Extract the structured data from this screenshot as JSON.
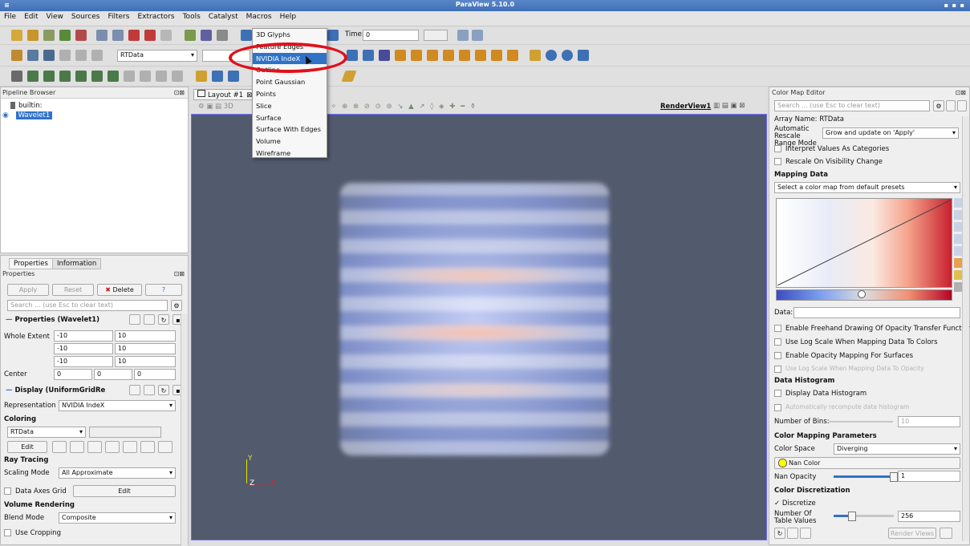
{
  "window": {
    "title": "ParaView 5.10.0",
    "controls": "▪ ▪ ▪"
  },
  "menubar": {
    "items": [
      "File",
      "Edit",
      "View",
      "Sources",
      "Filters",
      "Extractors",
      "Tools",
      "Catalyst",
      "Macros",
      "Help"
    ]
  },
  "toolbar": {
    "time_label": "Time:",
    "time_value": "0",
    "array_selector": "RTData"
  },
  "representation_menu": {
    "items": [
      "3D Glyphs",
      "Feature Edges",
      "NVIDIA IndeX",
      "Outline",
      "Point Gaussian",
      "Points",
      "Slice",
      "Surface",
      "Surface With Edges",
      "Volume",
      "Wireframe"
    ],
    "highlighted": "NVIDIA IndeX"
  },
  "pipeline": {
    "title": "Pipeline Browser",
    "root": "builtin:",
    "item": "Wavelet1"
  },
  "properties": {
    "tabs": [
      "Properties",
      "Information"
    ],
    "title": "Properties",
    "apply": "Apply",
    "reset": "Reset",
    "delete": "Delete",
    "help": "?",
    "search_placeholder": "Search ... (use Esc to clear text)",
    "section_props": "Properties (Wavelet1)",
    "whole_extent_label": "Whole Extent",
    "extent": [
      [
        "-10",
        "10"
      ],
      [
        "-10",
        "10"
      ],
      [
        "-10",
        "10"
      ]
    ],
    "center_label": "Center",
    "center": [
      "0",
      "0",
      "0"
    ],
    "section_display": "Display (UniformGridRe",
    "representation_label": "Representation",
    "representation_value": "NVIDIA IndeX",
    "coloring_label": "Coloring",
    "coloring_value": "RTData",
    "edit_label": "Edit",
    "ray_tracing_label": "Ray Tracing",
    "scaling_mode_label": "Scaling Mode",
    "scaling_mode_value": "All Approximate",
    "data_axes_grid": "Data Axes Grid",
    "data_axes_edit": "Edit",
    "volume_rendering_label": "Volume Rendering",
    "blend_mode_label": "Blend Mode",
    "blend_mode_value": "Composite",
    "use_cropping": "Use Cropping"
  },
  "view": {
    "layout_tab": "Layout #1",
    "render_view": "RenderView1",
    "axis_y": "Y",
    "axis_z": "Z",
    "axis_x": "X",
    "mode_3d": "3D"
  },
  "colormap": {
    "title": "Color Map Editor",
    "search_placeholder": "Search ... (use Esc to clear text)",
    "array_name": "Array Name: RTData",
    "auto_rescale_label": "Automatic Rescale Range Mode",
    "auto_rescale_value": "Grow and update on 'Apply'",
    "interpret_categories": "Interpret Values As Categories",
    "rescale_visibility": "Rescale On Visibility Change",
    "mapping_data": "Mapping Data",
    "preset_placeholder": "Select a color map from default presets",
    "data_label": "Data:",
    "freehand": "Enable Freehand Drawing Of Opacity Transfer Function",
    "log_scale": "Use Log Scale When Mapping Data To Colors",
    "opacity_mapping": "Enable Opacity Mapping For Surfaces",
    "log_scale_opacity": "Use Log Scale When Mapping Data To Opacity",
    "data_histogram": "Data Histogram",
    "display_histogram": "Display Data Histogram",
    "auto_recompute": "Automatically recompute data histogram",
    "num_bins_label": "Number of Bins:",
    "num_bins_value": "10",
    "color_mapping_params": "Color Mapping Parameters",
    "color_space_label": "Color Space",
    "color_space_value": "Diverging",
    "nan_color": "Nan Color",
    "nan_opacity_label": "Nan Opacity",
    "nan_opacity_value": "1",
    "color_discretization": "Color Discretization",
    "discretize": "Discretize",
    "num_table_values_label": "Number Of Table Values",
    "num_table_values": "256",
    "render_views": "Render Views"
  },
  "colors": {
    "accent": "#2f73c9",
    "view_bg": "#525a6e",
    "annotation": "#e0101a"
  }
}
